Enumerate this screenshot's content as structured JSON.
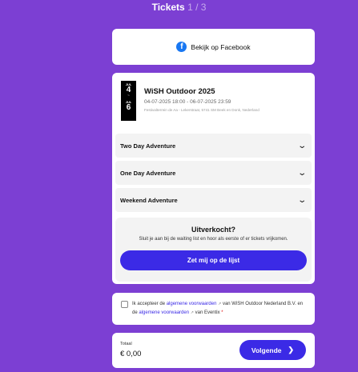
{
  "header": {
    "title": "Tickets",
    "step": "1 / 3"
  },
  "facebook": {
    "icon": "facebook-icon",
    "label": "Bekijk op Facebook"
  },
  "event": {
    "badge": {
      "month_start": "JUL",
      "day_start": "4",
      "sep": "~",
      "month_end": "JUL",
      "day_end": "6"
    },
    "title": "WiSH Outdoor 2025",
    "dates": "04-07-2025 18:00 - 06-07-2025 23:59",
    "location": "Festivalterrein de Aa - Lekerstraat, 5741 SM Beek en Donk, Nederland"
  },
  "tickets": [
    {
      "label": "Two Day Adventure"
    },
    {
      "label": "One Day Adventure"
    },
    {
      "label": "Weekend Adventure"
    }
  ],
  "soldout": {
    "title": "Uitverkocht?",
    "description": "Sluit je aan bij de waiting list en hoor als eerste of er tickets vrijkomen.",
    "button": "Zet mij op de lijst"
  },
  "terms": {
    "part1": "Ik accepteer de ",
    "link1": "algemene voorwaarden",
    "part2": " van WiSH Outdoor Nederland B.V. en de ",
    "link2": "algemene voorwaarden",
    "part3": " van Eventix",
    "required": "*"
  },
  "total": {
    "label": "Totaal",
    "value": "€ 0,00",
    "button": "Volgende"
  },
  "colors": {
    "background": "#7c3fd3",
    "accent": "#3b2ae6",
    "facebook": "#1877f2"
  }
}
